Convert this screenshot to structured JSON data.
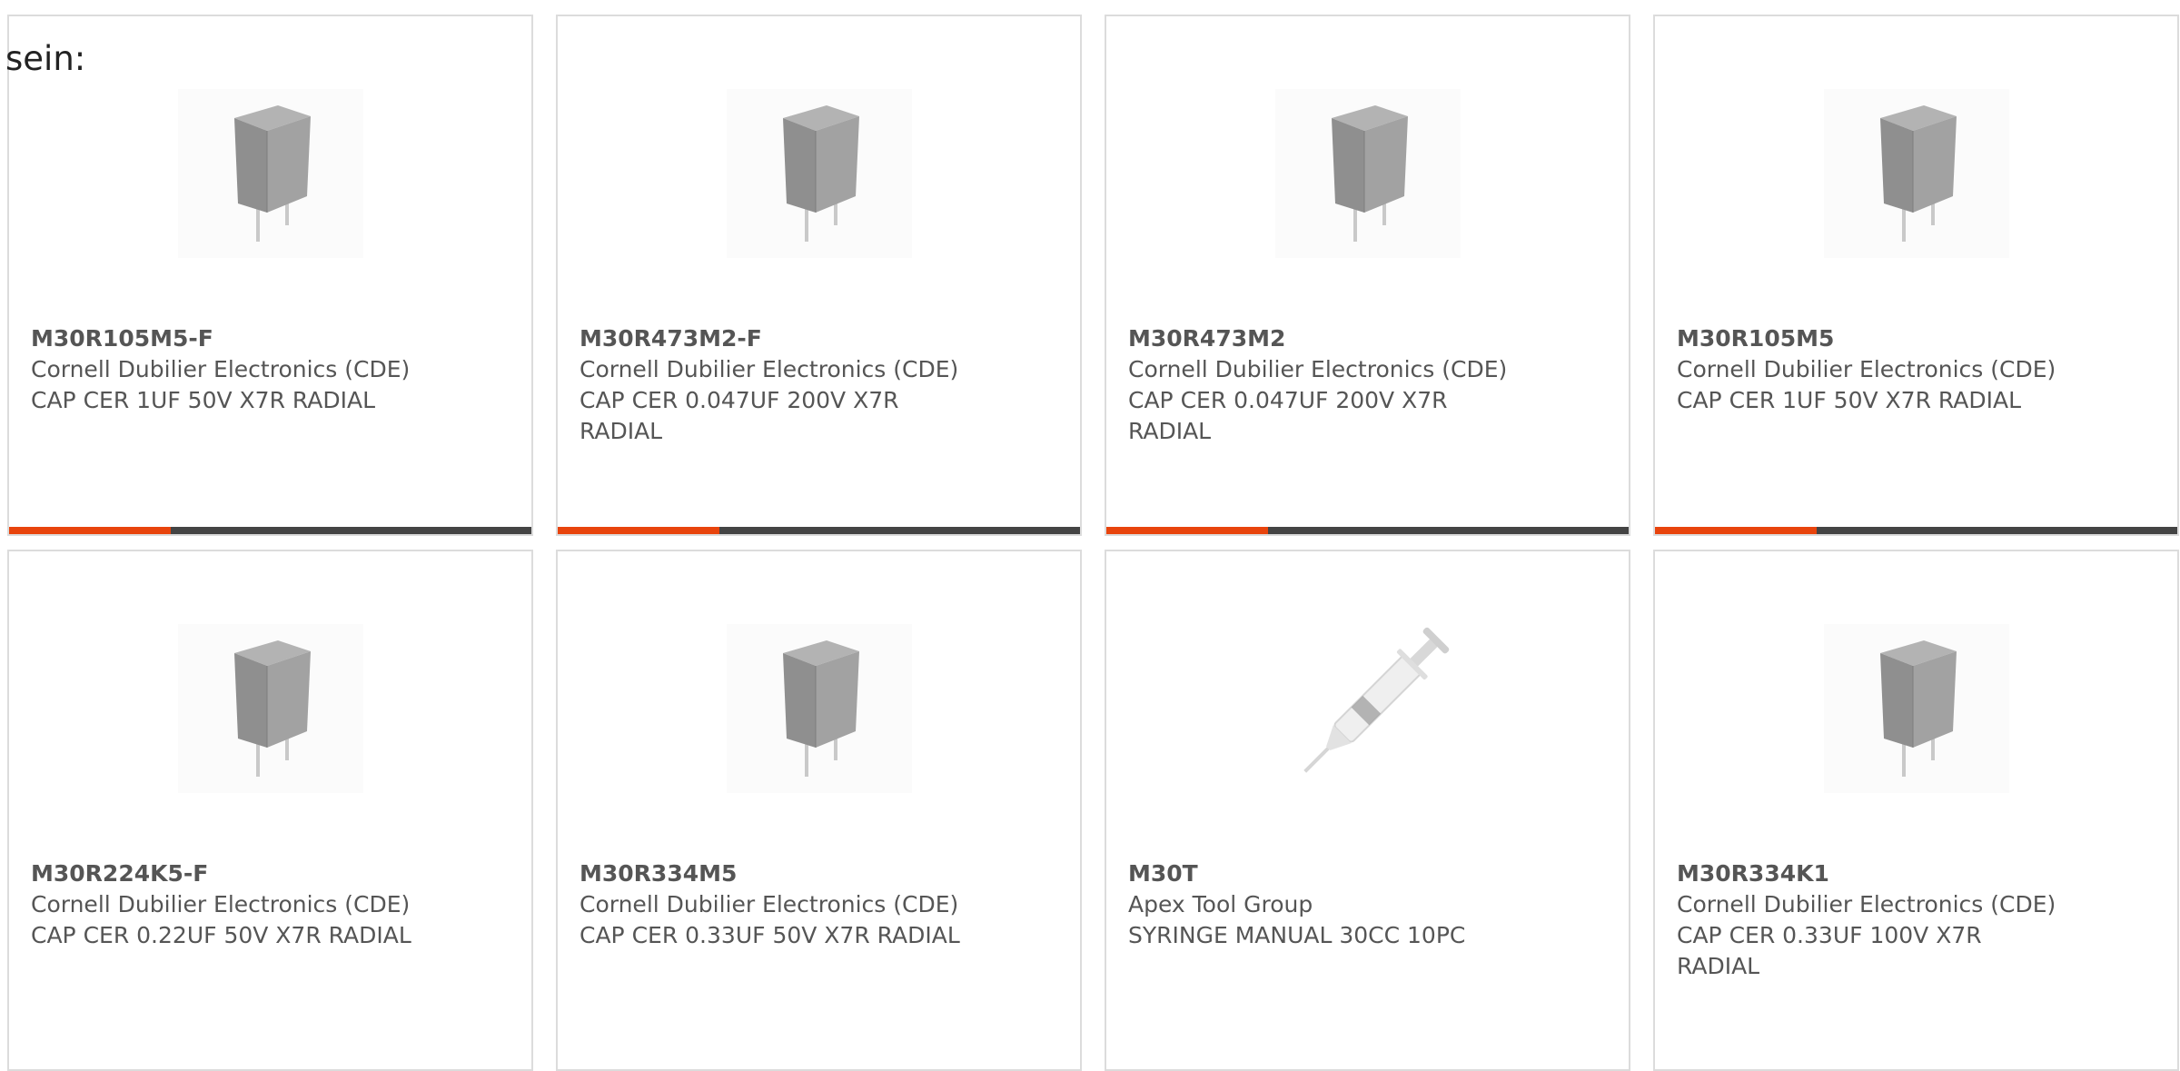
{
  "prefix_text": "sein:",
  "colors": {
    "accent": "#e8440d",
    "bar_track": "#444444",
    "card_border": "#dcdcdc",
    "text": "#555555"
  },
  "products": [
    {
      "part_number": "M30R105M5-F",
      "manufacturer": "Cornell Dubilier Electronics (CDE)",
      "description": "CAP CER 1UF 50V X7R RADIAL",
      "image": "capacitor-icon",
      "bar_fraction": 0.31
    },
    {
      "part_number": "M30R473M2-F",
      "manufacturer": "Cornell Dubilier Electronics (CDE)",
      "description": "CAP CER 0.047UF 200V X7R RADIAL",
      "image": "capacitor-icon",
      "bar_fraction": 0.31
    },
    {
      "part_number": "M30R473M2",
      "manufacturer": "Cornell Dubilier Electronics (CDE)",
      "description": "CAP CER 0.047UF 200V X7R RADIAL",
      "image": "capacitor-icon",
      "bar_fraction": 0.31
    },
    {
      "part_number": "M30R105M5",
      "manufacturer": "Cornell Dubilier Electronics (CDE)",
      "description": "CAP CER 1UF 50V X7R RADIAL",
      "image": "capacitor-icon",
      "bar_fraction": 0.31
    },
    {
      "part_number": "M30R224K5-F",
      "manufacturer": "Cornell Dubilier Electronics (CDE)",
      "description": "CAP CER 0.22UF 50V X7R RADIAL",
      "image": "capacitor-icon"
    },
    {
      "part_number": "M30R334M5",
      "manufacturer": "Cornell Dubilier Electronics (CDE)",
      "description": "CAP CER 0.33UF 50V X7R RADIAL",
      "image": "capacitor-icon"
    },
    {
      "part_number": "M30T",
      "manufacturer": "Apex Tool Group",
      "description": "SYRINGE MANUAL 30CC 10PC",
      "image": "syringe-icon"
    },
    {
      "part_number": "M30R334K1",
      "manufacturer": "Cornell Dubilier Electronics (CDE)",
      "description": "CAP CER 0.33UF 100V X7R RADIAL",
      "image": "capacitor-icon"
    }
  ]
}
